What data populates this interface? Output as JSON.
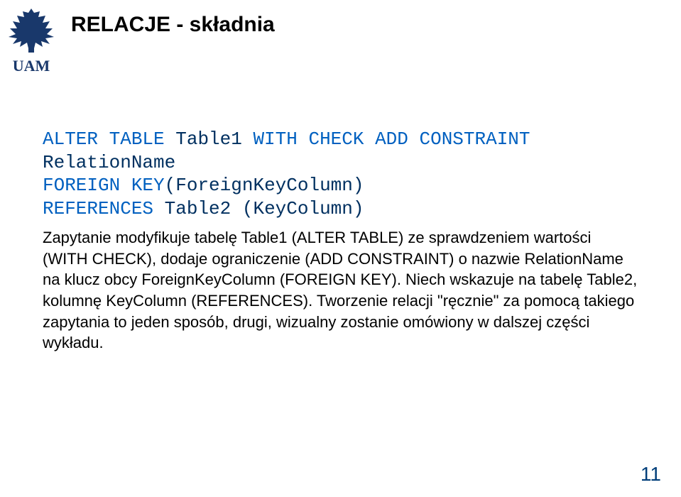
{
  "title": "RELACJE - składnia",
  "code": {
    "line1_kw1": "ALTER TABLE ",
    "line1_id1": "Table1 ",
    "line1_kw2": "WITH CHECK ADD CONSTRAINT",
    "line2_id1": "RelationName",
    "line3_kw1": "FOREIGN KEY",
    "line3_id1": "(ForeignKeyColumn)",
    "line4_kw1": "REFERENCES ",
    "line4_id1": "Table2 (KeyColumn)"
  },
  "paragraph": "Zapytanie modyfikuje tabelę Table1 (ALTER TABLE) ze sprawdzeniem wartości (WITH CHECK), dodaje ograniczenie (ADD CONSTRAINT) o nazwie RelationName na klucz obcy ForeignKeyColumn (FOREIGN KEY). Niech wskazuje na tabelę Table2, kolumnę KeyColumn (REFERENCES). Tworzenie relacji \"ręcznie\" za pomocą takiego zapytania to jeden sposób, drugi, wizualny zostanie omówiony w dalszej części wykładu.",
  "page_number": "11",
  "logo_text": "UAM"
}
